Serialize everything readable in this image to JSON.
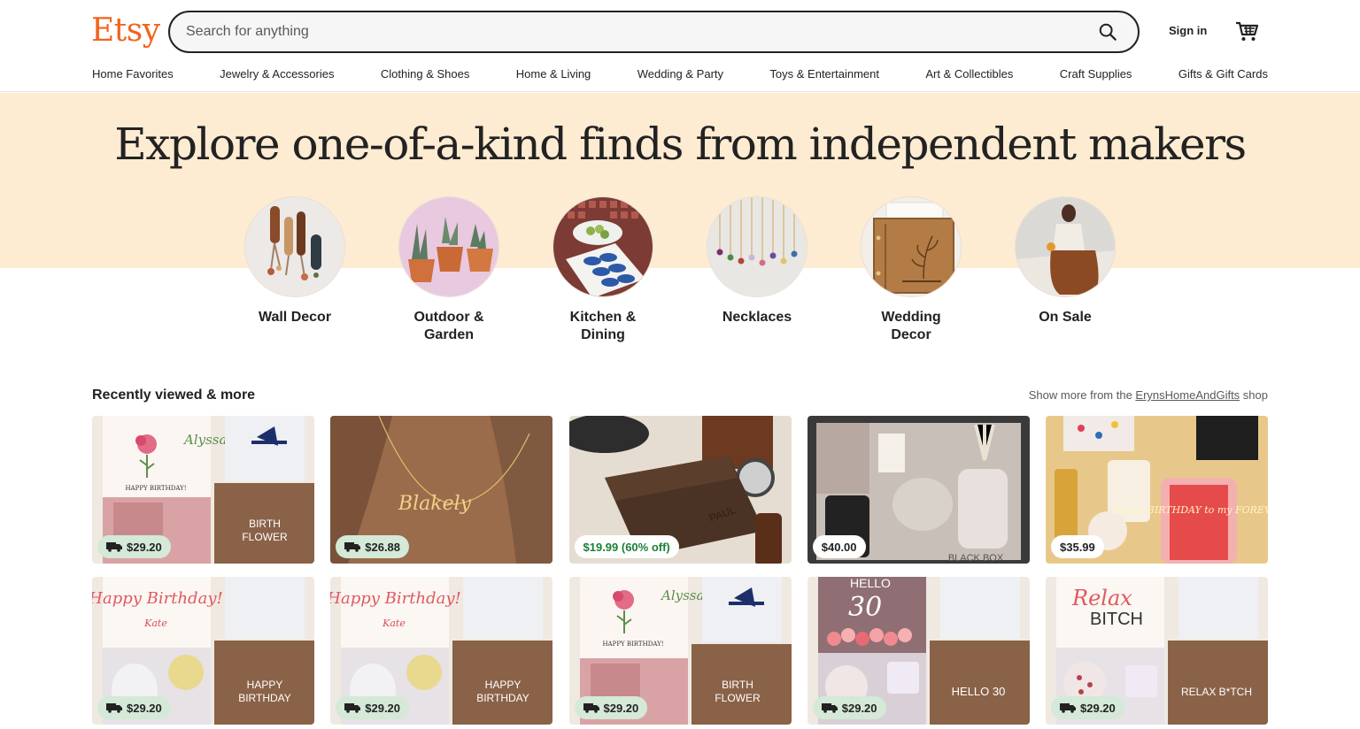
{
  "header": {
    "logo": "Etsy",
    "search_placeholder": "Search for anything",
    "sign_in": "Sign in"
  },
  "categories": [
    "Home Favorites",
    "Jewelry & Accessories",
    "Clothing & Shoes",
    "Home & Living",
    "Wedding & Party",
    "Toys & Entertainment",
    "Art & Collectibles",
    "Craft Supplies",
    "Gifts & Gift Cards"
  ],
  "hero": {
    "title": "Explore one-of-a-kind finds from independent makers",
    "circles": [
      {
        "label": "Wall Decor"
      },
      {
        "label": "Outdoor & Garden"
      },
      {
        "label": "Kitchen & Dining"
      },
      {
        "label": "Necklaces"
      },
      {
        "label": "Wedding Decor"
      },
      {
        "label": "On Sale"
      }
    ]
  },
  "recent": {
    "title": "Recently viewed & more",
    "more_prefix": "Show more from the ",
    "shop_name": "ErynsHomeAndGifts",
    "more_suffix": " shop",
    "items": [
      {
        "price": "$29.20",
        "shipping": true,
        "image_text": [
          "Alyssa",
          "HAPPY BIRTHDAY!",
          "BIRTH",
          "FLOWER"
        ]
      },
      {
        "price": "$26.88",
        "shipping": true,
        "image_text": [
          "Blakely"
        ]
      },
      {
        "price": "$19.99 (60% off)",
        "shipping": false,
        "sale": true,
        "image_text": [
          "PAUL"
        ]
      },
      {
        "price": "$40.00",
        "shipping": false,
        "image_text": [
          "BLACK BOX"
        ]
      },
      {
        "price": "$35.99",
        "shipping": false,
        "image_text": [
          "Happy BIRTHDAY to my FOREVER"
        ]
      },
      {
        "price": "$29.20",
        "shipping": true,
        "image_text": [
          "Happy Birthday!",
          "Kate",
          "HAPPY",
          "BIRTHDAY"
        ]
      },
      {
        "price": "$29.20",
        "shipping": true,
        "image_text": [
          "Happy Birthday!",
          "Kate",
          "HAPPY",
          "BIRTHDAY"
        ]
      },
      {
        "price": "$29.20",
        "shipping": true,
        "image_text": [
          "Alyssa",
          "HAPPY BIRTHDAY!",
          "BIRTH",
          "FLOWER"
        ]
      },
      {
        "price": "$29.20",
        "shipping": true,
        "image_text": [
          "HELLO",
          "30",
          "HELLO 30"
        ]
      },
      {
        "price": "$29.20",
        "shipping": true,
        "image_text": [
          "Relax",
          "BITCH",
          "RELAX B*TCH"
        ]
      }
    ]
  },
  "colors": {
    "brand": "#f1641e",
    "hero_bg": "#fdebd2",
    "shipping_badge": "#d4e9d7",
    "sale_text": "#1a7f37"
  },
  "icons": [
    "search-icon",
    "cart-icon",
    "truck-icon"
  ]
}
